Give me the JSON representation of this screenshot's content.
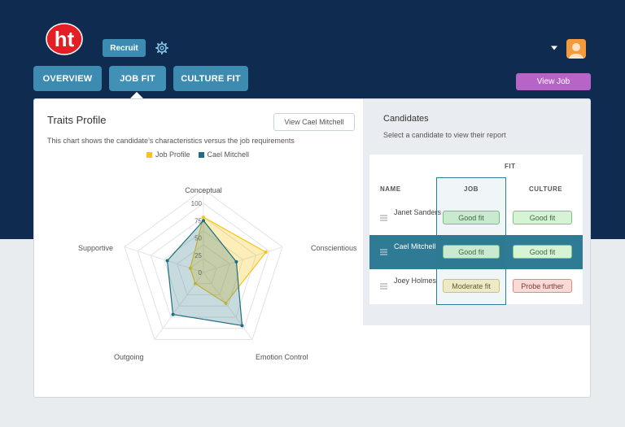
{
  "brand": {
    "logo_text": "ht",
    "logo_color": "#e31e24"
  },
  "header": {
    "recruit_label": "Recruit",
    "view_job_label": "View Job"
  },
  "tabs": [
    {
      "label": "OVERVIEW"
    },
    {
      "label": "JOB FIT",
      "active": true
    },
    {
      "label": "CULTURE FIT"
    }
  ],
  "traits": {
    "title": "Traits Profile",
    "view_button": "View Cael Mitchell",
    "description": "This chart shows the candidate's characteristics versus the job requirements"
  },
  "chart_data": {
    "type": "radar",
    "axes": [
      "Conceptual",
      "Conscientious",
      "Emotion Control",
      "Outgoing",
      "Supportive"
    ],
    "ticks": [
      "0",
      "25",
      "50",
      "75",
      "100"
    ],
    "range": [
      0,
      100
    ],
    "series": [
      {
        "name": "Job Profile",
        "color": "#f5c518",
        "values": [
          80,
          95,
          55,
          20,
          20
        ]
      },
      {
        "name": "Cael Mitchell",
        "color": "#1f6e80",
        "values": [
          75,
          50,
          95,
          75,
          55
        ]
      }
    ]
  },
  "candidates": {
    "title": "Candidates",
    "subtitle": "Select a candidate to view their report",
    "group_header": "FIT",
    "columns": {
      "name": "NAME",
      "job": "JOB",
      "culture": "CULTURE"
    },
    "rows": [
      {
        "name": "Janet Sanders",
        "job": "Good fit",
        "job_status": "good",
        "culture": "Good fit",
        "culture_status": "good",
        "selected": false
      },
      {
        "name": "Cael Mitchell",
        "job": "Good fit",
        "job_status": "good",
        "culture": "Good fit",
        "culture_status": "good",
        "selected": true
      },
      {
        "name": "Joey Holmes",
        "job": "Moderate fit",
        "job_status": "moderate",
        "culture": "Probe further",
        "culture_status": "probe",
        "selected": false
      }
    ]
  },
  "colors": {
    "navy": "#0f2b50",
    "teal": "#3d8bb0",
    "purple": "#b665c6",
    "selected_row": "#2f7a94"
  }
}
